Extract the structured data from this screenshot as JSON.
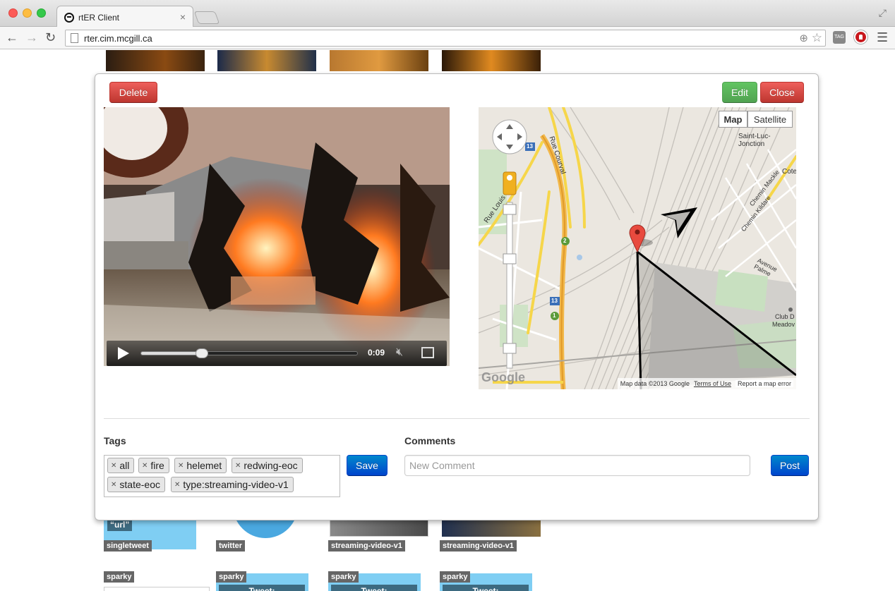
{
  "browser": {
    "tab_title": "rtER Client",
    "url": "rter.cim.mcgill.ca",
    "ext_tag_label": "TAG"
  },
  "background": {
    "bottom_tiles": [
      {
        "label": "singletweet",
        "tweet_text": "&ldquo;url&rdquo;"
      },
      {
        "label": "twitter"
      },
      {
        "label": "streaming-video-v1"
      },
      {
        "label": "streaming-video-v1"
      }
    ],
    "sparky_tiles": [
      {
        "label": "sparky"
      },
      {
        "label": "sparky",
        "tweet_text": "Tweet:"
      },
      {
        "label": "sparky",
        "tweet_text": "Tweet:"
      },
      {
        "label": "sparky",
        "tweet_text": "Tweet:"
      }
    ]
  },
  "modal": {
    "delete_label": "Delete",
    "edit_label": "Edit",
    "close_label": "Close",
    "video": {
      "time": "0:09",
      "progress": 0.28
    },
    "map": {
      "map_label": "Map",
      "satellite_label": "Satellite",
      "map_type_selected": "Map",
      "labels": {
        "place1": "Saint-Luc-Jonction",
        "place2": "Cote",
        "street1": "Rue Courval",
        "street2": "Rue Louis",
        "street3": "Chemin Mackle",
        "street4": "Chemin Kildare",
        "street5": "Avenue Palme",
        "club": "Club D",
        "meadow": "Meadov",
        "route13a": "13",
        "route13b": "13",
        "route2": "2",
        "route1": "1"
      },
      "google": "Google",
      "map_data": "Map data ©2013 Google",
      "terms": "Terms of Use",
      "report": "Report a map error"
    },
    "tags_heading": "Tags",
    "tags": [
      "all",
      "fire",
      "helemet",
      "redwing-eoc",
      "state-eoc",
      "type:streaming-video-v1"
    ],
    "save_label": "Save",
    "comments_heading": "Comments",
    "comment_placeholder": "New Comment",
    "post_label": "Post"
  }
}
